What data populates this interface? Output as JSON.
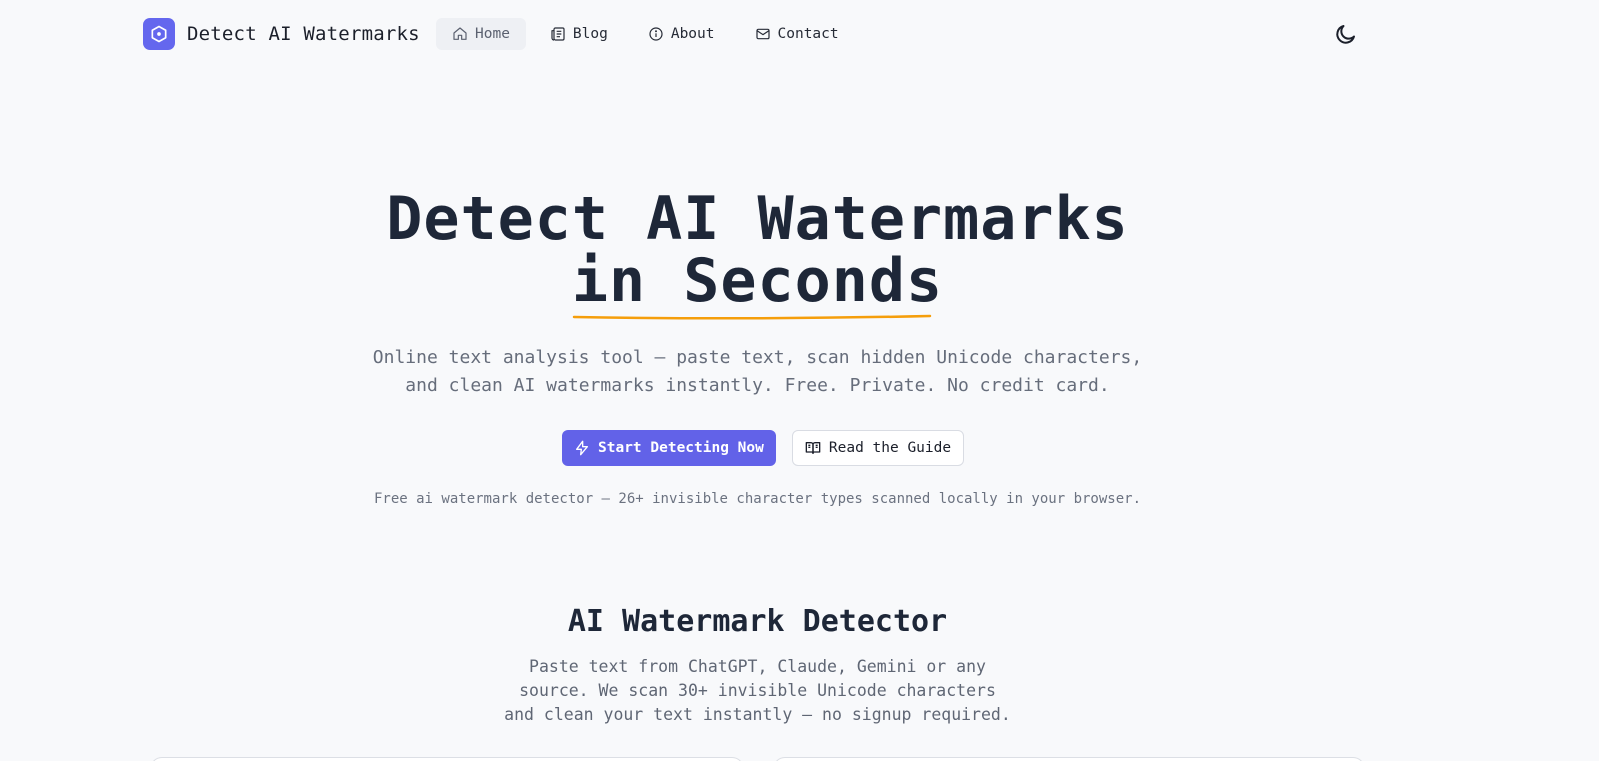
{
  "nav": {
    "brand": "Detect AI Watermarks",
    "links": [
      {
        "label": "Home",
        "icon": "home-icon"
      },
      {
        "label": "Blog",
        "icon": "newspaper-icon"
      },
      {
        "label": "About",
        "icon": "info-icon"
      },
      {
        "label": "Contact",
        "icon": "mail-icon"
      }
    ],
    "theme_icon": "moon-icon"
  },
  "hero": {
    "title_line1": "Detect AI Watermarks",
    "title_line2": "in Seconds",
    "subtitle_line1": "Online text analysis tool — paste text, scan hidden Unicode characters,",
    "subtitle_line2": "and clean AI watermarks instantly. Free. Private. No credit card.",
    "primary_cta": "Start Detecting Now",
    "secondary_cta": "Read the Guide",
    "note": "Free ai watermark detector — 26+ invisible character types scanned locally in your browser."
  },
  "detector": {
    "title": "AI Watermark Detector",
    "sub_line1": "Paste text from ChatGPT, Claude, Gemini or any",
    "sub_line2": "source. We scan 30+ invisible Unicode characters",
    "sub_line3": "and clean your text instantly — no signup required."
  },
  "colors": {
    "accent": "#6262e8",
    "underline": "#f59e0b",
    "background": "#f8f9fb"
  }
}
